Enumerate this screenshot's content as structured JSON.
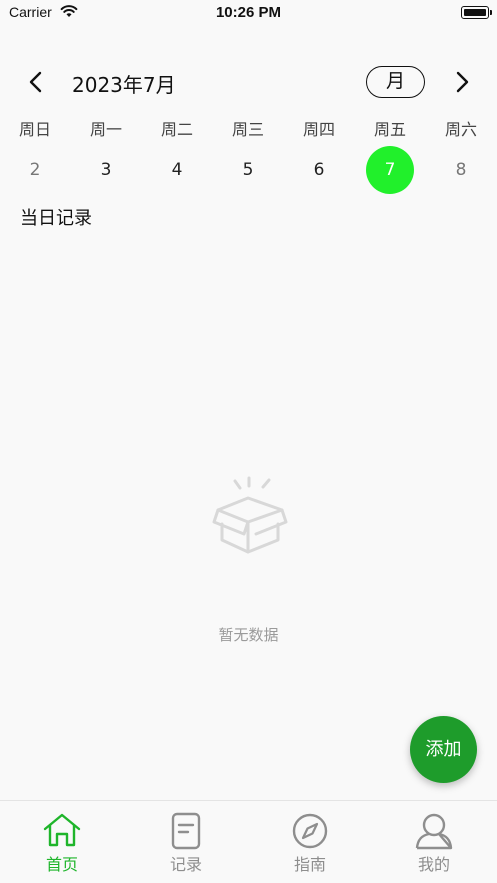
{
  "status_bar": {
    "carrier": "Carrier",
    "time": "10:26 PM"
  },
  "header": {
    "month_title": "2023年7月",
    "view_toggle": "月"
  },
  "week": [
    {
      "weekday": "周日",
      "day": "2"
    },
    {
      "weekday": "周一",
      "day": "3"
    },
    {
      "weekday": "周二",
      "day": "4"
    },
    {
      "weekday": "周三",
      "day": "5"
    },
    {
      "weekday": "周四",
      "day": "6"
    },
    {
      "weekday": "周五",
      "day": "7",
      "selected": true
    },
    {
      "weekday": "周六",
      "day": "8"
    }
  ],
  "records": {
    "title": "当日记录",
    "empty_text": "暂无数据"
  },
  "fab": {
    "label": "添加"
  },
  "tabs": [
    {
      "label": "首页",
      "icon": "home-icon",
      "active": true
    },
    {
      "label": "记录",
      "icon": "document-icon"
    },
    {
      "label": "指南",
      "icon": "compass-icon"
    },
    {
      "label": "我的",
      "icon": "user-icon"
    }
  ],
  "colors": {
    "selected_day": "#21f02b",
    "fab": "#1e9c2b",
    "active_tab": "#1fb52b",
    "inactive_tab": "#8e8e8e"
  }
}
